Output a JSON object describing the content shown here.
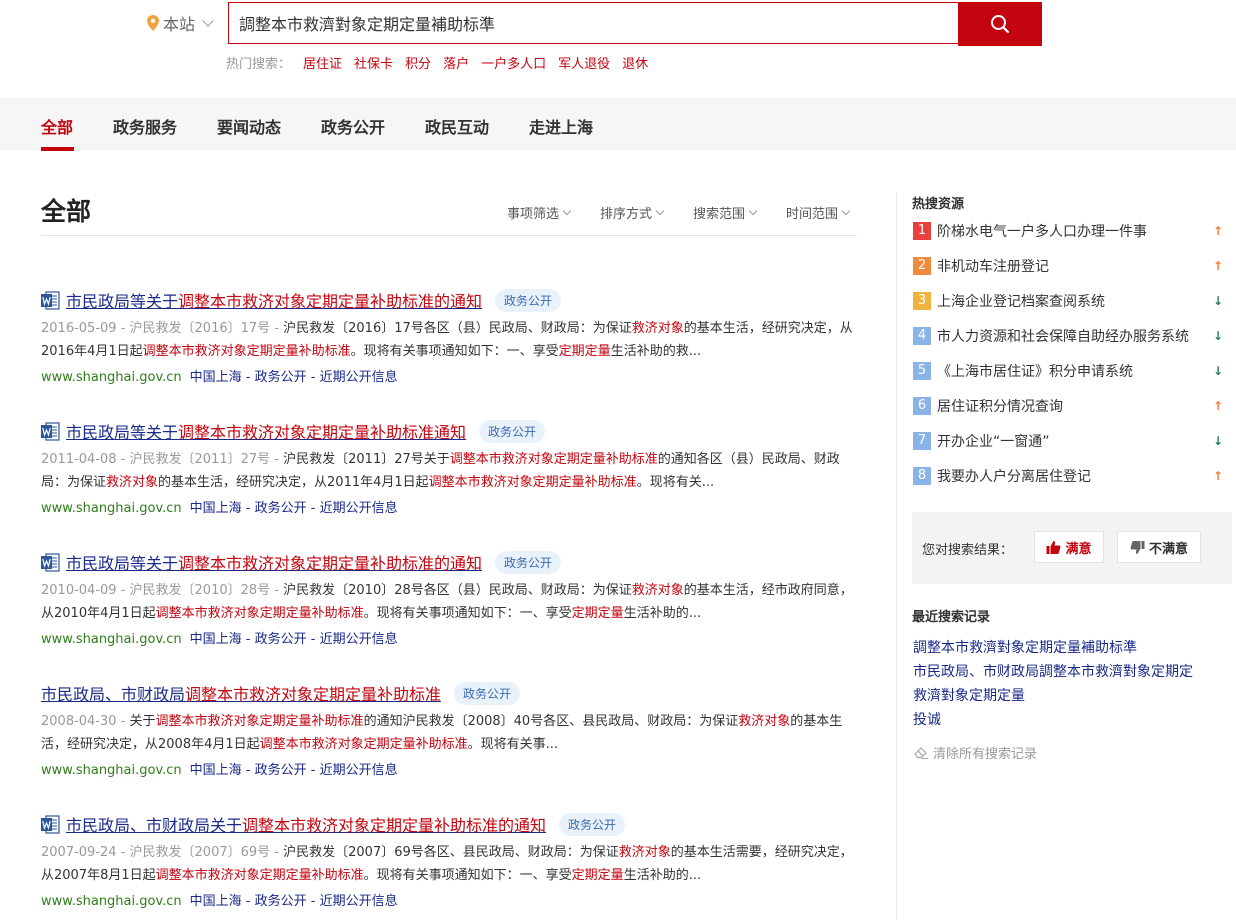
{
  "search": {
    "scope_label": "本站",
    "query": "調整本市救濟對象定期定量補助标準",
    "hot_label": "热门搜索：",
    "hot_terms": [
      "居住证",
      "社保卡",
      "积分",
      "落户",
      "一户多人口",
      "军人退役",
      "退休"
    ]
  },
  "nav": {
    "tabs": [
      "全部",
      "政务服务",
      "要闻动态",
      "政务公开",
      "政民互动",
      "走进上海"
    ]
  },
  "main": {
    "title": "全部",
    "filters": [
      "事项筛选",
      "排序方式",
      "搜索范围",
      "时间范围"
    ]
  },
  "results": [
    {
      "title_pre": "市民政局等关于",
      "title_hl": "调整本市救济对象定期定量补助标准的通知",
      "tag": "政务公开",
      "date": "2016-05-09",
      "doc_no": "沪民救发〔2016〕17号",
      "d1": "沪民救发〔2016〕17号各区（县）民政局、财政局：为保证",
      "d1_hl": "救济对象",
      "d2": "的基本生活，经研究决定，从2016年4月1日起",
      "d2_hl": "调整本市救济对象定期定量补助标准",
      "d3": "。现将有关事项通知如下：一、享受",
      "d3_hl": "定期定量",
      "d4": "生活补助的救...",
      "url": "www.shanghai.gov.cn",
      "crumb": "中国上海 - 政务公开 - 近期公开信息"
    },
    {
      "title_pre": "市民政局等关于",
      "title_hl": "调整本市救济对象定期定量补助标准通知",
      "tag": "政务公开",
      "date": "2011-04-08",
      "doc_no": "沪民救发〔2011〕27号",
      "d1": "沪民救发〔2011〕27号关于",
      "d1_hl": "调整本市救济对象定期定量补助标准",
      "d2": "的通知各区（县）民政局、财政局：为保证",
      "d2_hl": "救济对象",
      "d3": "的基本生活，经研究决定，从2011年4月1日起",
      "d3_hl": "调整本市救济对象定期定量补助标准",
      "d4": "。现将有关...",
      "url": "www.shanghai.gov.cn",
      "crumb": "中国上海 - 政务公开 - 近期公开信息"
    },
    {
      "title_pre": "市民政局等关于",
      "title_hl": "调整本市救济对象定期定量补助标准的通知",
      "tag": "政务公开",
      "date": "2010-04-09",
      "doc_no": "沪民救发〔2010〕28号",
      "d1": "沪民救发〔2010〕28号各区（县）民政局、财政局：为保证",
      "d1_hl": "救济对象",
      "d2": "的基本生活，经市政府同意，从2010年4月1日起",
      "d2_hl": "调整本市救济对象定期定量补助标准",
      "d3": "。现将有关事项通知如下：一、享受",
      "d3_hl": "定期定量",
      "d4": "生活补助的...",
      "url": "www.shanghai.gov.cn",
      "crumb": "中国上海 - 政务公开 - 近期公开信息"
    },
    {
      "title_pre": "市民政局、市财政局",
      "title_hl": "调整本市救济对象定期定量补助标准",
      "tag": "政务公开",
      "date": "2008-04-30",
      "doc_no": "",
      "d1": "关于",
      "d1_hl": "调整本市救济对象定期定量补助标准",
      "d2": "的通知沪民救发〔2008〕40号各区、县民政局、财政局：为保证",
      "d2_hl": "救济对象",
      "d3": "的基本生活，经研究决定，从2008年4月1日起",
      "d3_hl": "调整本市救济对象定期定量补助标准",
      "d4": "。现将有关事...",
      "url": "www.shanghai.gov.cn",
      "crumb": "中国上海 - 政务公开 - 近期公开信息"
    },
    {
      "title_pre": "市民政局、市财政局关于",
      "title_hl": "调整本市救济对象定期定量补助标准的通知",
      "tag": "政务公开",
      "date": "2007-09-24",
      "doc_no": "沪民救发〔2007〕69号",
      "d1": "沪民救发〔2007〕69号各区、县民政局、财政局：为保证",
      "d1_hl": "救济对象",
      "d2": "的基本生活需要，经研究决定，从2007年8月1日起",
      "d2_hl": "调整本市救济对象定期定量补助标准",
      "d3": "。现将有关事项通知如下：一、享受",
      "d3_hl": "定期定量",
      "d4": "生活补助的...",
      "url": "www.shanghai.gov.cn",
      "crumb": "中国上海 - 政务公开 - 近期公开信息"
    }
  ],
  "sidebar": {
    "hot_title": "热搜资源",
    "hot_items": [
      {
        "rank": "1",
        "label": "阶梯水电气一户多人口办理一件事",
        "trend": "up"
      },
      {
        "rank": "2",
        "label": "非机动车注册登记",
        "trend": "up"
      },
      {
        "rank": "3",
        "label": "上海企业登记档案查阅系统",
        "trend": "down"
      },
      {
        "rank": "4",
        "label": "市人力资源和社会保障自助经办服务系统",
        "trend": "down"
      },
      {
        "rank": "5",
        "label": "《上海市居住证》积分申请系统",
        "trend": "down"
      },
      {
        "rank": "6",
        "label": "居住证积分情况查询",
        "trend": "up"
      },
      {
        "rank": "7",
        "label": "开办企业“一窗通”",
        "trend": "down"
      },
      {
        "rank": "8",
        "label": "我要办人户分离居住登记",
        "trend": "up"
      }
    ],
    "rank_colors": [
      "#e8413c",
      "#f28a3d",
      "#f2b33d",
      "#8ab4e8",
      "#8ab4e8",
      "#8ab4e8",
      "#8ab4e8",
      "#8ab4e8"
    ],
    "feedback_label": "您对搜索结果：",
    "satisfied": "满意",
    "unsatisfied": "不满意",
    "recent_title": "最近搜索记录",
    "recent": [
      "調整本市救濟對象定期定量補助标準",
      "市民政局、市财政局調整本市救濟對象定期定",
      "救濟對象定期定量",
      "投诚"
    ],
    "clear_label": "清除所有搜索记录"
  }
}
